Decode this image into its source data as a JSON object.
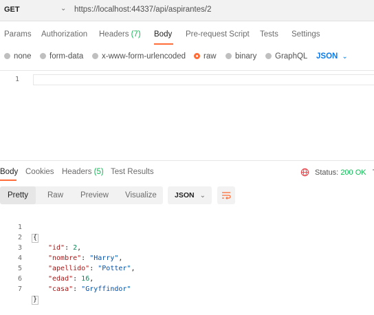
{
  "request": {
    "method": "GET",
    "url": "https://localhost:44337/api/aspirantes/2"
  },
  "request_tabs": [
    {
      "label": "Params"
    },
    {
      "label": "Authorization"
    },
    {
      "label": "Headers",
      "count": "(7)"
    },
    {
      "label": "Body",
      "active": true
    },
    {
      "label": "Pre-request Script"
    },
    {
      "label": "Tests"
    },
    {
      "label": "Settings"
    }
  ],
  "body_types": [
    {
      "label": "none"
    },
    {
      "label": "form-data"
    },
    {
      "label": "x-www-form-urlencoded"
    },
    {
      "label": "raw",
      "selected": true
    },
    {
      "label": "binary"
    },
    {
      "label": "GraphQL"
    }
  ],
  "body_format": "JSON",
  "request_editor": {
    "line_number": "1"
  },
  "response_tabs": [
    {
      "label": "Body",
      "active": true
    },
    {
      "label": "Cookies"
    },
    {
      "label": "Headers",
      "count": "(5)"
    },
    {
      "label": "Test Results"
    }
  ],
  "status": {
    "label": "Status:",
    "value": "200 OK",
    "trailing": "T"
  },
  "view_modes": [
    {
      "label": "Pretty",
      "active": true
    },
    {
      "label": "Raw"
    },
    {
      "label": "Preview"
    },
    {
      "label": "Visualize"
    }
  ],
  "response_format": "JSON",
  "response_lines": [
    {
      "no": "1",
      "text": "{"
    },
    {
      "no": "2",
      "key": "\"id\"",
      "value": "2",
      "type": "number",
      "comma": ","
    },
    {
      "no": "3",
      "key": "\"nombre\"",
      "value": "\"Harry\"",
      "type": "string",
      "comma": ","
    },
    {
      "no": "4",
      "key": "\"apellido\"",
      "value": "\"Potter\"",
      "type": "string",
      "comma": ","
    },
    {
      "no": "5",
      "key": "\"edad\"",
      "value": "16",
      "type": "number",
      "comma": ","
    },
    {
      "no": "6",
      "key": "\"casa\"",
      "value": "\"Gryffindor\"",
      "type": "string",
      "comma": ""
    },
    {
      "no": "7",
      "text": "}"
    }
  ],
  "icons": {
    "method_dropdown": "chevron-down-icon",
    "globe": "globe-icon",
    "wrap": "wrap-lines-icon"
  },
  "colors": {
    "accent": "#ff6c37",
    "success": "#0cbb52",
    "link": "#097bed"
  }
}
